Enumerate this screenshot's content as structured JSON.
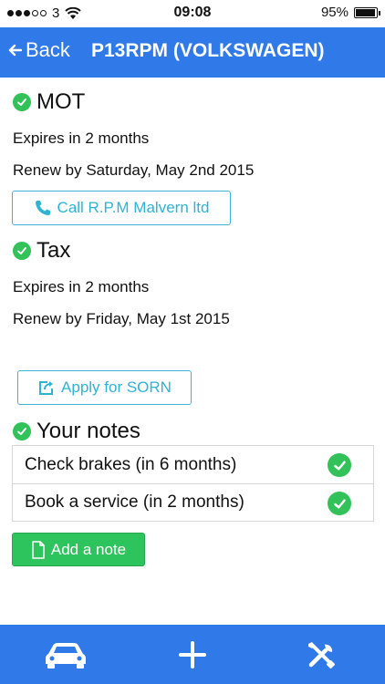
{
  "status_bar": {
    "carrier": "3",
    "time": "09:08",
    "battery": "95%",
    "battery_level": 0.95
  },
  "nav": {
    "back_label": "Back",
    "title": "P13RPM (VOLKSWAGEN)"
  },
  "mot": {
    "title": "MOT",
    "expires": "Expires in 2 months",
    "renew": "Renew by Saturday, May 2nd 2015",
    "call_label": "Call R.P.M Malvern ltd"
  },
  "tax": {
    "title": "Tax",
    "expires": "Expires in 2 months",
    "renew": "Renew by Friday, May 1st 2015",
    "sorn_label": "Apply for SORN"
  },
  "notes": {
    "title": "Your notes",
    "items": [
      {
        "text": "Check brakes (in 6 months)"
      },
      {
        "text": "Book a service (in 2 months)"
      }
    ],
    "add_label": "Add a note"
  },
  "tabs": [
    {
      "icon": "car-icon"
    },
    {
      "icon": "plus-icon"
    },
    {
      "icon": "tools-icon"
    }
  ],
  "colors": {
    "primary": "#2f79e9",
    "success": "#32c259",
    "outline": "#3bb5d6"
  }
}
